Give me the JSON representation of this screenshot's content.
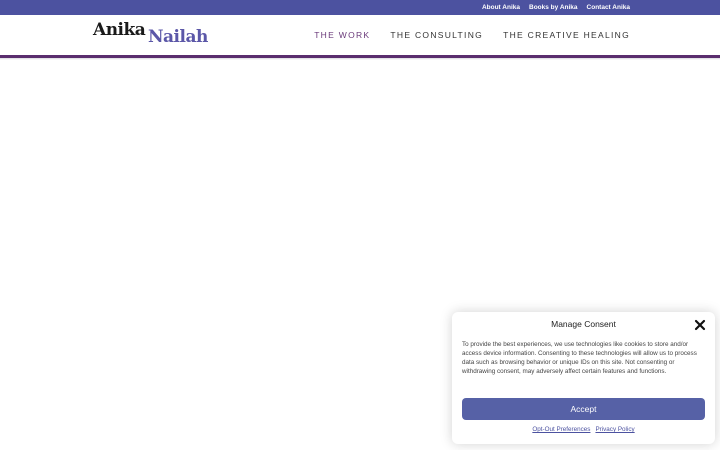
{
  "topbar": {
    "links": [
      "About Anika",
      "Books by Anika",
      "Contact Anika"
    ]
  },
  "logo": {
    "word1": "Anika",
    "word2": "Nailah"
  },
  "nav": {
    "items": [
      "THE WORK",
      "THE CONSULTING",
      "THE CREATIVE HEALING"
    ]
  },
  "consent": {
    "title": "Manage Consent",
    "body": "To provide the best experiences, we use technologies like cookies to store and/or access device information. Consenting to these technologies will allow us to process data such as browsing behavior or unique IDs on this site. Not consenting or withdrawing consent, may adversely affect certain features and functions.",
    "accept_label": "Accept",
    "opt_out_label": "Opt-Out Preferences",
    "privacy_label": "Privacy Policy"
  },
  "colors": {
    "topbar": "#4c52a0",
    "accent": "#5a2d6e",
    "button": "#5661a6"
  },
  "icons": [
    "close-icon"
  ]
}
